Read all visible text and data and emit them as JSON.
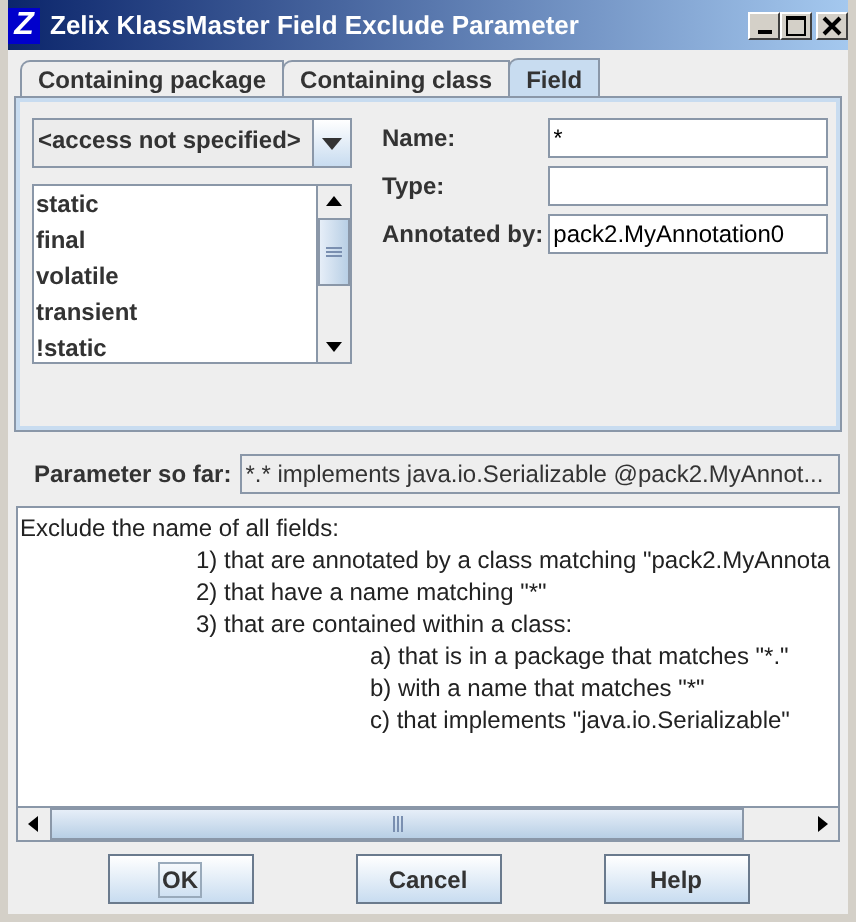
{
  "window": {
    "app_icon": "Z",
    "title": "Zelix KlassMaster Field Exclude Parameter"
  },
  "tabs": [
    {
      "label": "Containing package",
      "selected": false
    },
    {
      "label": "Containing class",
      "selected": false
    },
    {
      "label": "Field",
      "selected": true
    }
  ],
  "access_dropdown": {
    "value": "<access not specified>"
  },
  "modifiers": [
    {
      "label": "static",
      "selected": false
    },
    {
      "label": "final",
      "selected": false
    },
    {
      "label": "volatile",
      "selected": false
    },
    {
      "label": "transient",
      "selected": false
    },
    {
      "label": "!static",
      "selected": false
    }
  ],
  "form": [
    {
      "label": "Name:",
      "value": "*"
    },
    {
      "label": "Type:"
    },
    {
      "label": "Annotated by:",
      "value": "pack2.MyAnnotation0"
    }
  ],
  "parameter": {
    "label": "Parameter so far:",
    "value": "*.* implements java.io.Serializable @pack2.MyAnnot..."
  },
  "description": [
    {
      "text": "Exclude the name of all fields:",
      "children": [
        {
          "text": "1) that are annotated by a class matching \"pack2.MyAnnota"
        },
        {
          "text": "2) that have a name matching \"*\""
        },
        {
          "text": "3) that are contained within a class:",
          "children": [
            {
              "text": "a) that is in a package that matches \"*.\""
            },
            {
              "text": "b) with a name that matches \"*\""
            },
            {
              "text": "c) that implements \"java.io.Serializable\""
            }
          ]
        }
      ]
    }
  ],
  "buttons": [
    {
      "label": "OK",
      "focused": true
    },
    {
      "label": "Cancel",
      "focused": false
    },
    {
      "label": "Help",
      "focused": false
    }
  ]
}
